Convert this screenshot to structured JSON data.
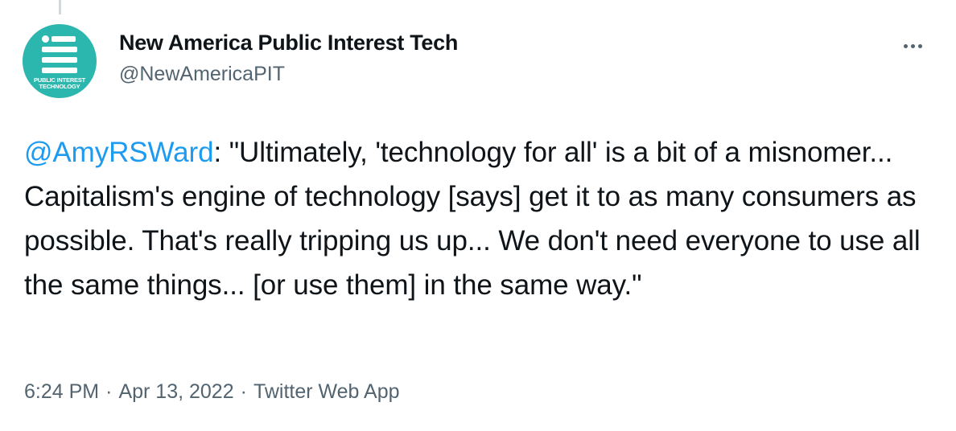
{
  "author": {
    "display_name": "New America Public Interest Tech",
    "handle": "@NewAmericaPIT",
    "avatar_logo_text": [
      "PUBLIC INTEREST",
      "TECHNOLOGY"
    ],
    "avatar_color": "#2bb7ad"
  },
  "more_menu_icon": "more-horizontal-icon",
  "tweet": {
    "mention": "@AmyRSWard",
    "body": ": \"Ultimately, 'technology for all' is a bit of a misnomer... Capitalism's engine of technology [says] get it to as many consumers as possible. That's really tripping us up... We don't need everyone to use all the same things... [or use them] in the same way.\""
  },
  "meta": {
    "time": "6:24 PM",
    "date": "Apr 13, 2022",
    "separator": "·",
    "source": "Twitter Web App"
  },
  "colors": {
    "text": "#0f1419",
    "secondary": "#536471",
    "link": "#1d9bf0"
  }
}
